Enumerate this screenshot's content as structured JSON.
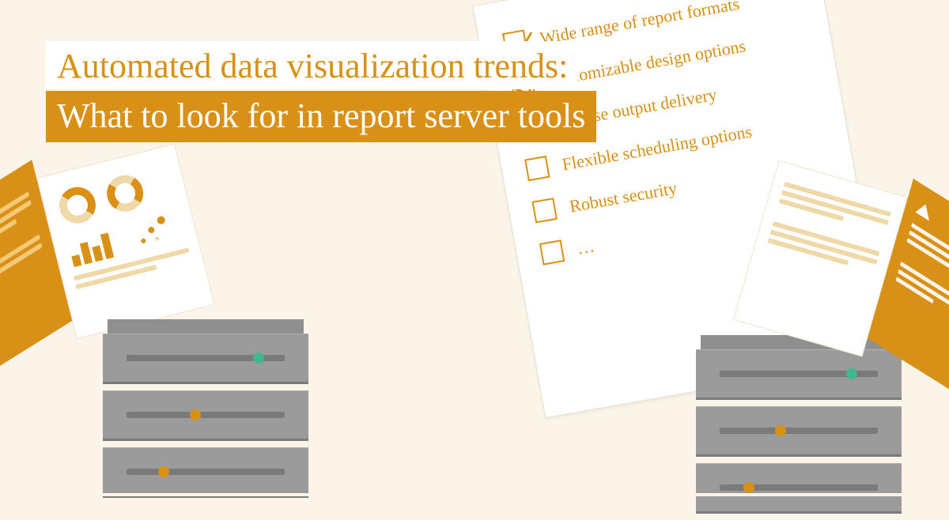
{
  "title": {
    "line1": "Automated data visualization trends:",
    "line2": "What to look for in report server tools"
  },
  "checklist": {
    "items": [
      {
        "checked": true,
        "label": "Wide range of report formats"
      },
      {
        "checked": true,
        "label": "Customizable design options"
      },
      {
        "checked": true,
        "label": "Diverse output delivery"
      },
      {
        "checked": false,
        "label": "Flexible scheduling options"
      },
      {
        "checked": false,
        "label": "Robust security"
      },
      {
        "checked": false,
        "label": "…"
      }
    ]
  },
  "colors": {
    "accent": "#d99016",
    "bg": "#faf5e8",
    "server": "#9b9b9b",
    "dot_green": "#3fb98c"
  }
}
